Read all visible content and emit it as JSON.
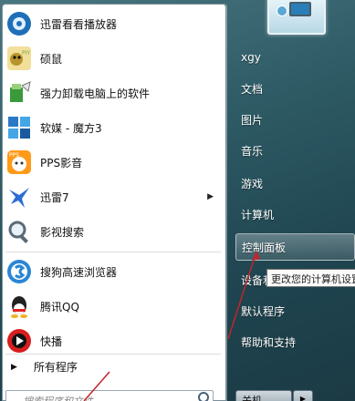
{
  "programs": [
    {
      "label": "迅雷看看播放器",
      "icon": "xunlei-kankan-icon",
      "color": "#1f6fb8"
    },
    {
      "label": "硕鼠",
      "icon": "shuoshu-icon",
      "color": "#e8c04a"
    },
    {
      "label": "强力卸载电脑上的软件",
      "icon": "uninstall-icon",
      "color": "#3a9a3a"
    },
    {
      "label": "软媒 - 魔方3",
      "icon": "mofang-icon",
      "color": "#2b78c7"
    },
    {
      "label": "PPS影音",
      "icon": "pps-icon",
      "color": "#ff9a1a"
    },
    {
      "label": "迅雷7",
      "icon": "xunlei-icon",
      "color": "#2a6ed6",
      "has_submenu": true
    },
    {
      "label": "影视搜索",
      "icon": "video-search-icon",
      "color": "#6a6a6a"
    },
    {
      "label": "搜狗高速浏览器",
      "icon": "sogou-browser-icon",
      "color": "#2a86d6"
    },
    {
      "label": "腾讯QQ",
      "icon": "qq-icon",
      "color": "#222222"
    },
    {
      "label": "快播",
      "icon": "kuaibo-icon",
      "color": "#d61e1e"
    }
  ],
  "all_programs": "所有程序",
  "search_placeholder": "搜索程序和文件",
  "right_items": [
    {
      "label": "xgy"
    },
    {
      "label": "文档"
    },
    {
      "label": "图片"
    },
    {
      "label": "音乐"
    },
    {
      "label": "游戏"
    },
    {
      "label": "计算机"
    },
    {
      "label": "控制面板",
      "highlighted": true
    },
    {
      "label": "设备和"
    },
    {
      "label": "默认程序"
    },
    {
      "label": "帮助和支持"
    }
  ],
  "tooltip": "更改您的计算机设置",
  "shutdown_label": "关机",
  "colors": {
    "accent_arrow": "#c0262b",
    "highlight": "#ffffff"
  }
}
